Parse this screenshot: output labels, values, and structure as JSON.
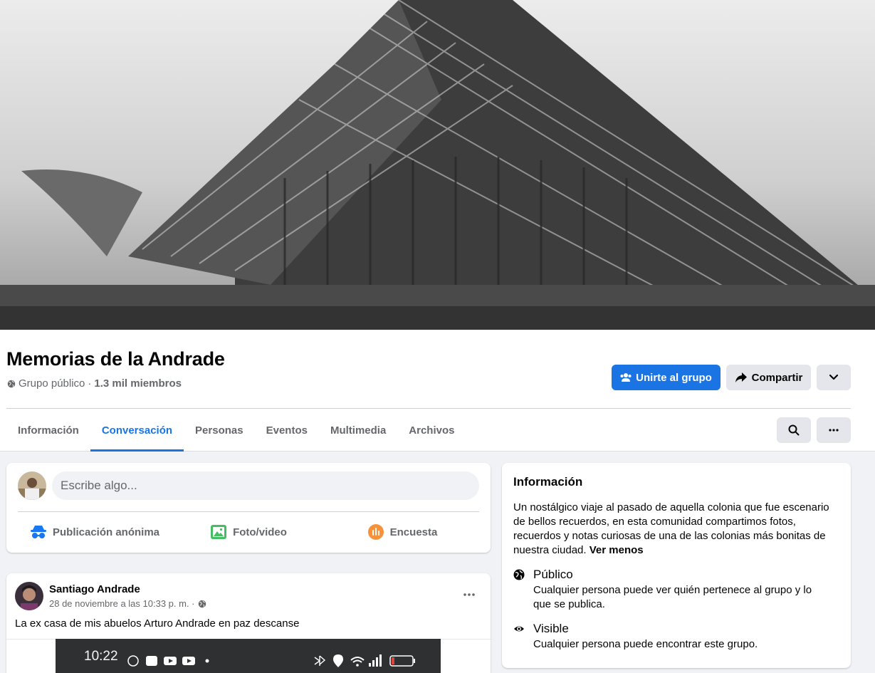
{
  "group": {
    "name": "Memorias de la Andrade",
    "privacy": "Grupo público",
    "separator": "·",
    "members": "1.3 mil miembros"
  },
  "buttons": {
    "join": "Unirte al grupo",
    "share": "Compartir"
  },
  "tabs": [
    {
      "label": "Información"
    },
    {
      "label": "Conversación",
      "active": true
    },
    {
      "label": "Personas"
    },
    {
      "label": "Eventos"
    },
    {
      "label": "Multimedia"
    },
    {
      "label": "Archivos"
    }
  ],
  "composer": {
    "placeholder": "Escribe algo...",
    "actions": [
      {
        "label": "Publicación anónima",
        "icon": "incognito-icon",
        "color": "#1877f2"
      },
      {
        "label": "Foto/video",
        "icon": "photo-icon",
        "color": "#45bd62"
      },
      {
        "label": "Encuesta",
        "icon": "poll-icon",
        "color": "#f7923b"
      }
    ]
  },
  "post": {
    "author": "Santiago Andrade",
    "timestamp": "28 de noviembre a las 10:33 p. m. ·",
    "text": "La ex casa de mis abuelos Arturo Andrade en paz descanse",
    "image_status_time": "10:22"
  },
  "about": {
    "title": "Información",
    "description": "Un nostálgico viaje al pasado de aquella colonia que fue escenario de bellos recuerdos, en esta comunidad compartimos fotos, recuerdos y notas curiosas de una de las colonias más bonitas de nuestra ciudad.",
    "see_less": "Ver menos",
    "items": [
      {
        "title": "Público",
        "desc": "Cualquier persona puede ver quién pertenece al grupo y lo que se publica.",
        "icon": "globe-icon"
      },
      {
        "title": "Visible",
        "desc": "Cualquier persona puede encontrar este grupo.",
        "icon": "eye-icon"
      }
    ]
  },
  "colors": {
    "accent": "#1b74e4",
    "secondary_text": "#65676b",
    "page_bg": "#f0f2f5"
  }
}
